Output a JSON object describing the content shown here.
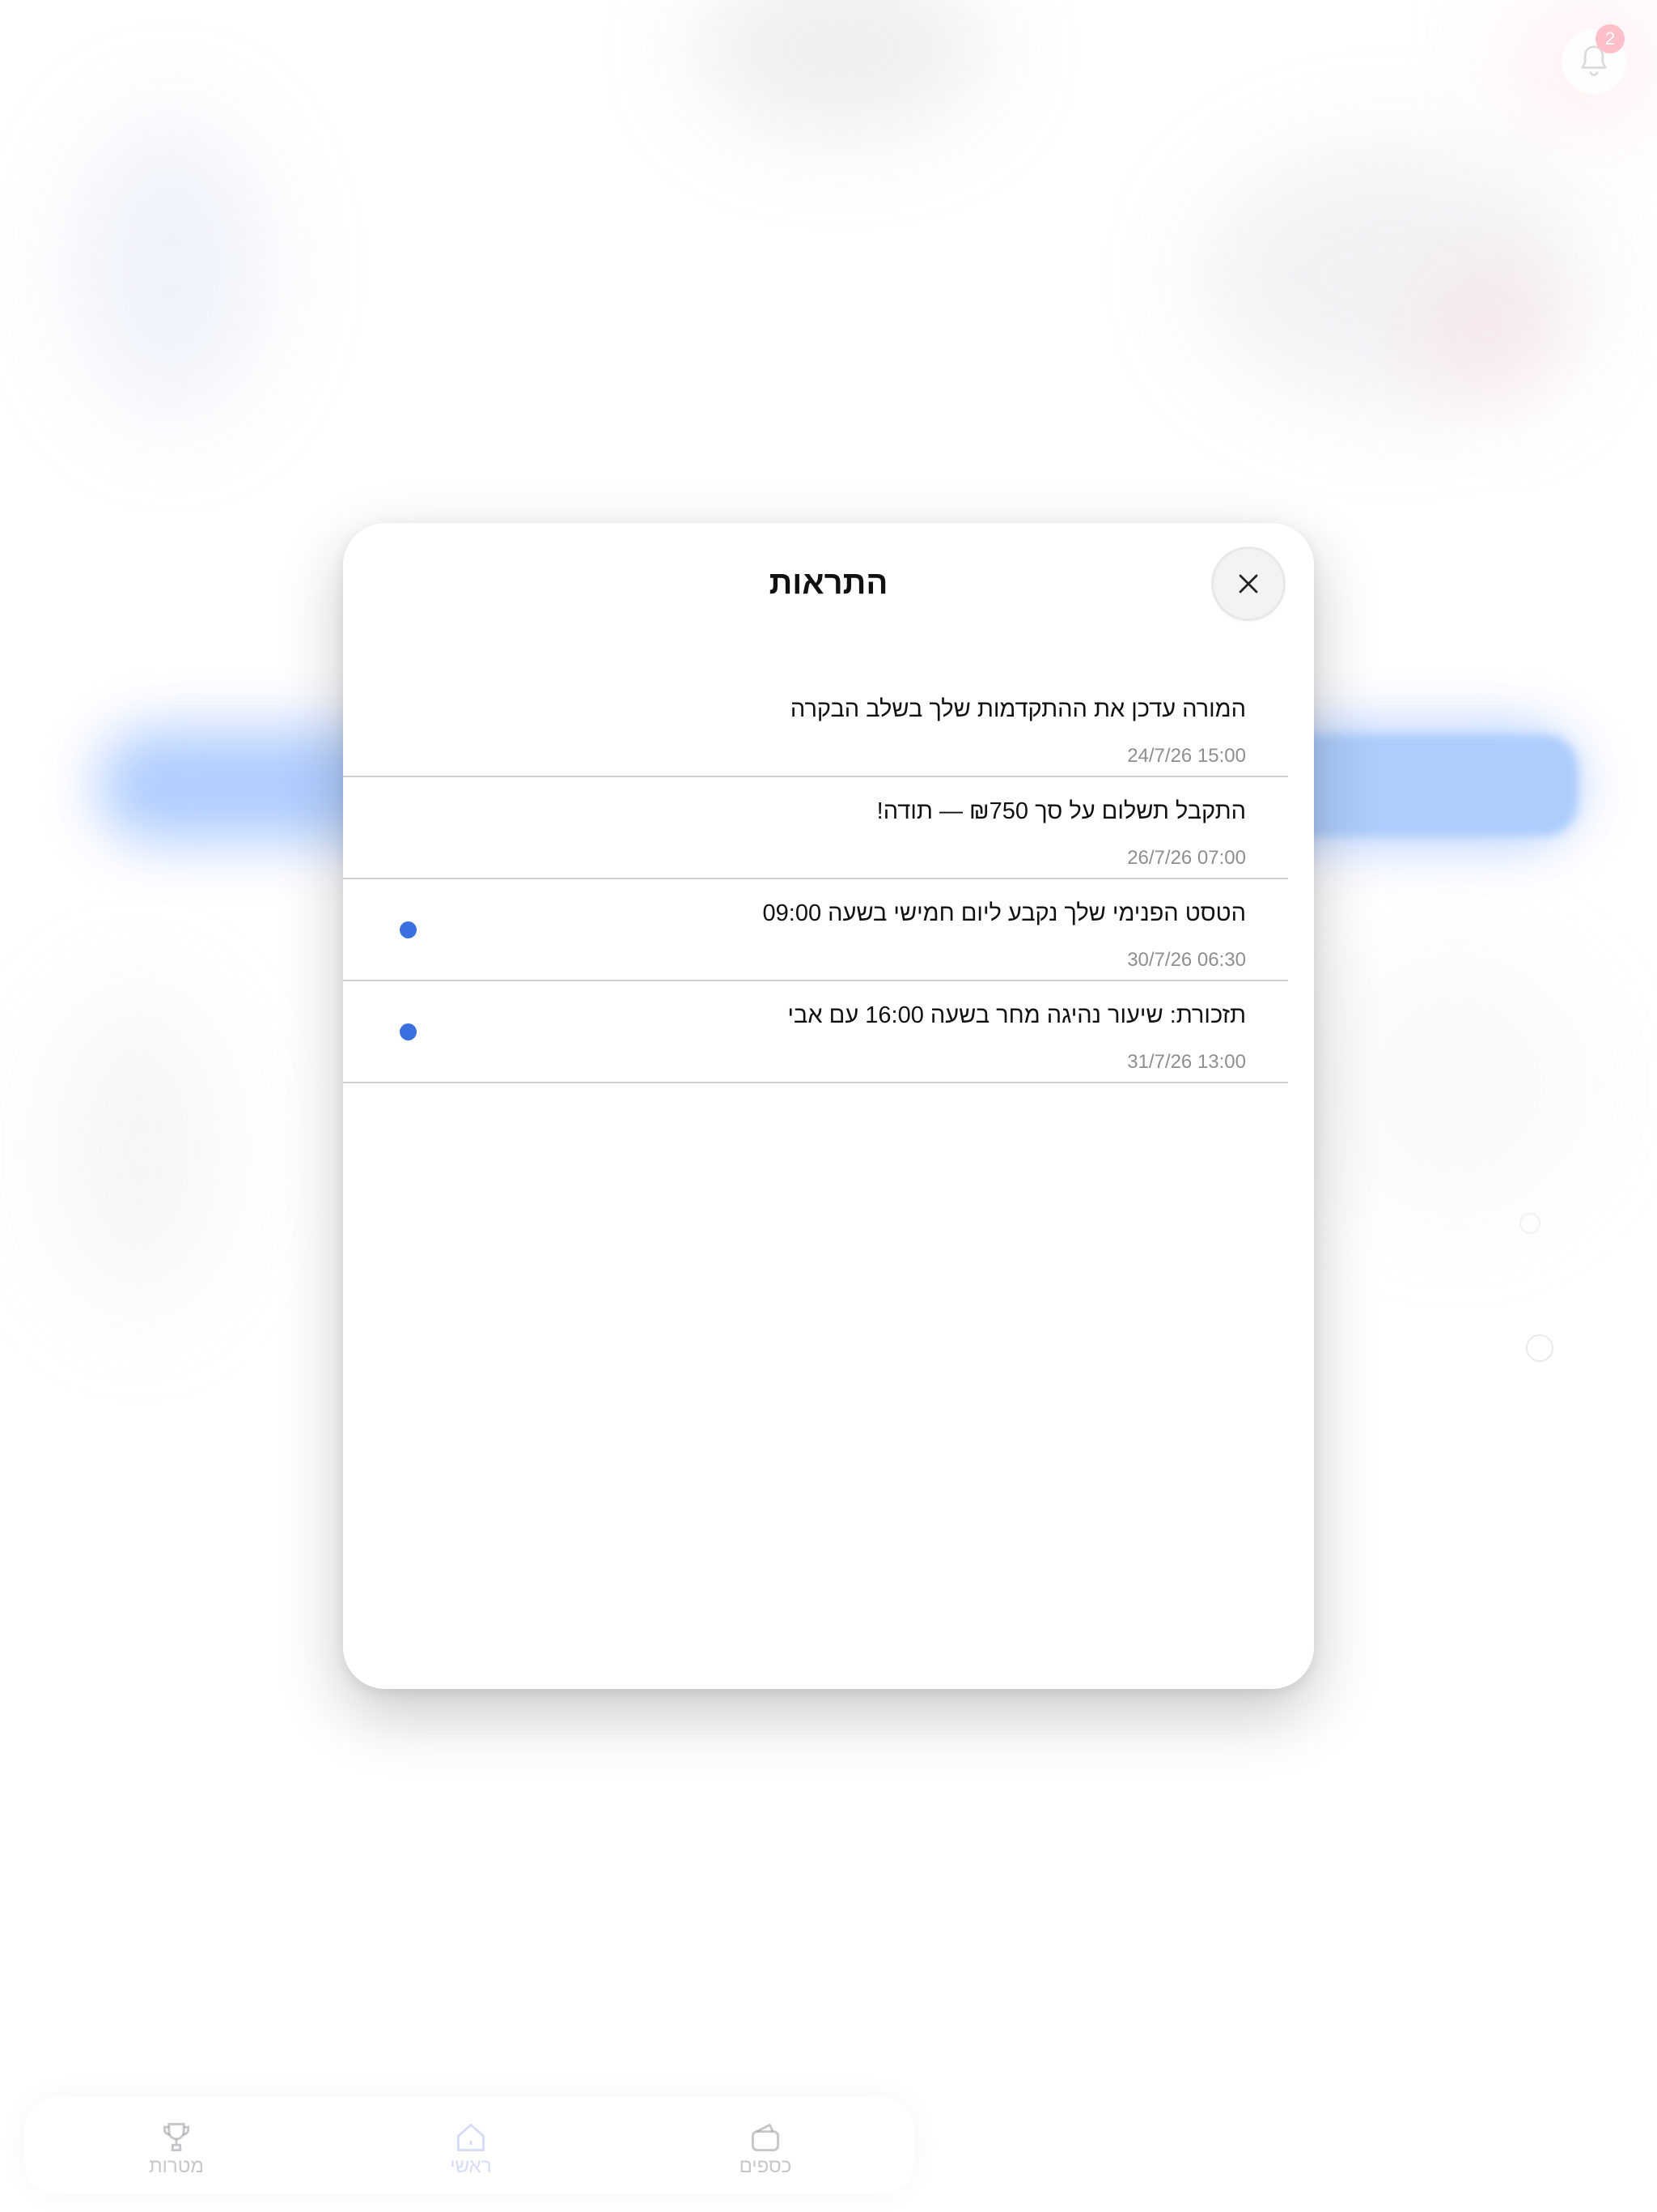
{
  "header": {
    "notification_count": "2"
  },
  "modal": {
    "title": "התראות",
    "close_icon": "close-icon",
    "items": [
      {
        "text": "המורה עדכן את ההתקדמות שלך בשלב הבקרה",
        "time": "24/7/26 15:00",
        "unread": false
      },
      {
        "text": "התקבל תשלום על סך ₪750 — תודה!",
        "time": "26/7/26 07:00",
        "unread": false
      },
      {
        "text": "הטסט הפנימי שלך נקבע ליום חמישי בשעה 09:00",
        "time": "30/7/26 06:30",
        "unread": true
      },
      {
        "text": "תזכורת: שיעור נהיגה מחר בשעה 16:00 עם אבי",
        "time": "31/7/26 13:00",
        "unread": true
      }
    ]
  },
  "tabbar": {
    "goals_label": "מטרות",
    "home_label": "ראשי",
    "money_label": "כספים"
  },
  "colors": {
    "unread_dot": "#3a6fe0",
    "badge": "#ffb2bf",
    "accent_blue": "#8fb8ff"
  }
}
